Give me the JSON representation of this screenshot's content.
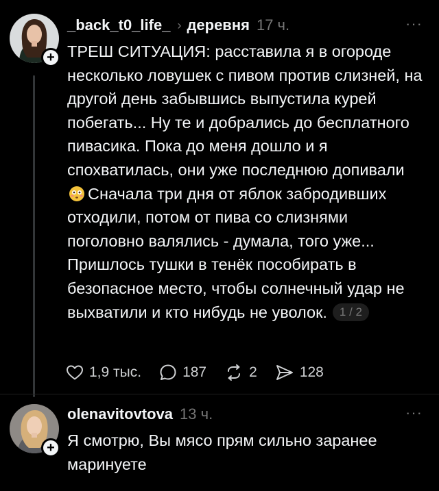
{
  "post": {
    "username": "_back_t0_life_",
    "topic": "деревня",
    "time": "17 ч.",
    "more_label": "···",
    "follow_label": "+",
    "text_before_emoji": "ТРЕШ СИТУАЦИЯ: расставила я в огороде несколько ловушек с пивом против слизней, на другой день забывшись выпустила курей побегать... Ну те и добрались до бесплатного пивасика. Пока до меня дошло и я спохватилась, они уже последнюю допивали",
    "text_after_emoji": "Сначала три дня от яблок забродивших отходили, потом от пива со слизнями поголовно валялись - думала, того уже... Пришлось тушки в тенёк пособирать в безопасное место, чтобы солнечный удар не выхватили и кто нибудь не уволок.",
    "emoji": "flushed-face-emoji",
    "page_indicator": "1 / 2",
    "actions": {
      "likes": "1,9 тыс.",
      "replies": "187",
      "reposts": "2",
      "shares": "128"
    }
  },
  "reply": {
    "username": "olenavitovtova",
    "time": "13 ч.",
    "more_label": "···",
    "follow_label": "+",
    "text": "Я смотрю,  Вы мясо прям сильно заранее маринуете"
  },
  "icons": {
    "like": "heart-icon",
    "reply": "comment-bubble-icon",
    "repost": "repost-icon",
    "share": "send-icon",
    "follow": "plus-icon",
    "more": "more-dots-icon"
  },
  "colors": {
    "background": "#000000",
    "text": "#f3f5f7",
    "muted": "#777777",
    "badge": "#f3f5f7"
  }
}
